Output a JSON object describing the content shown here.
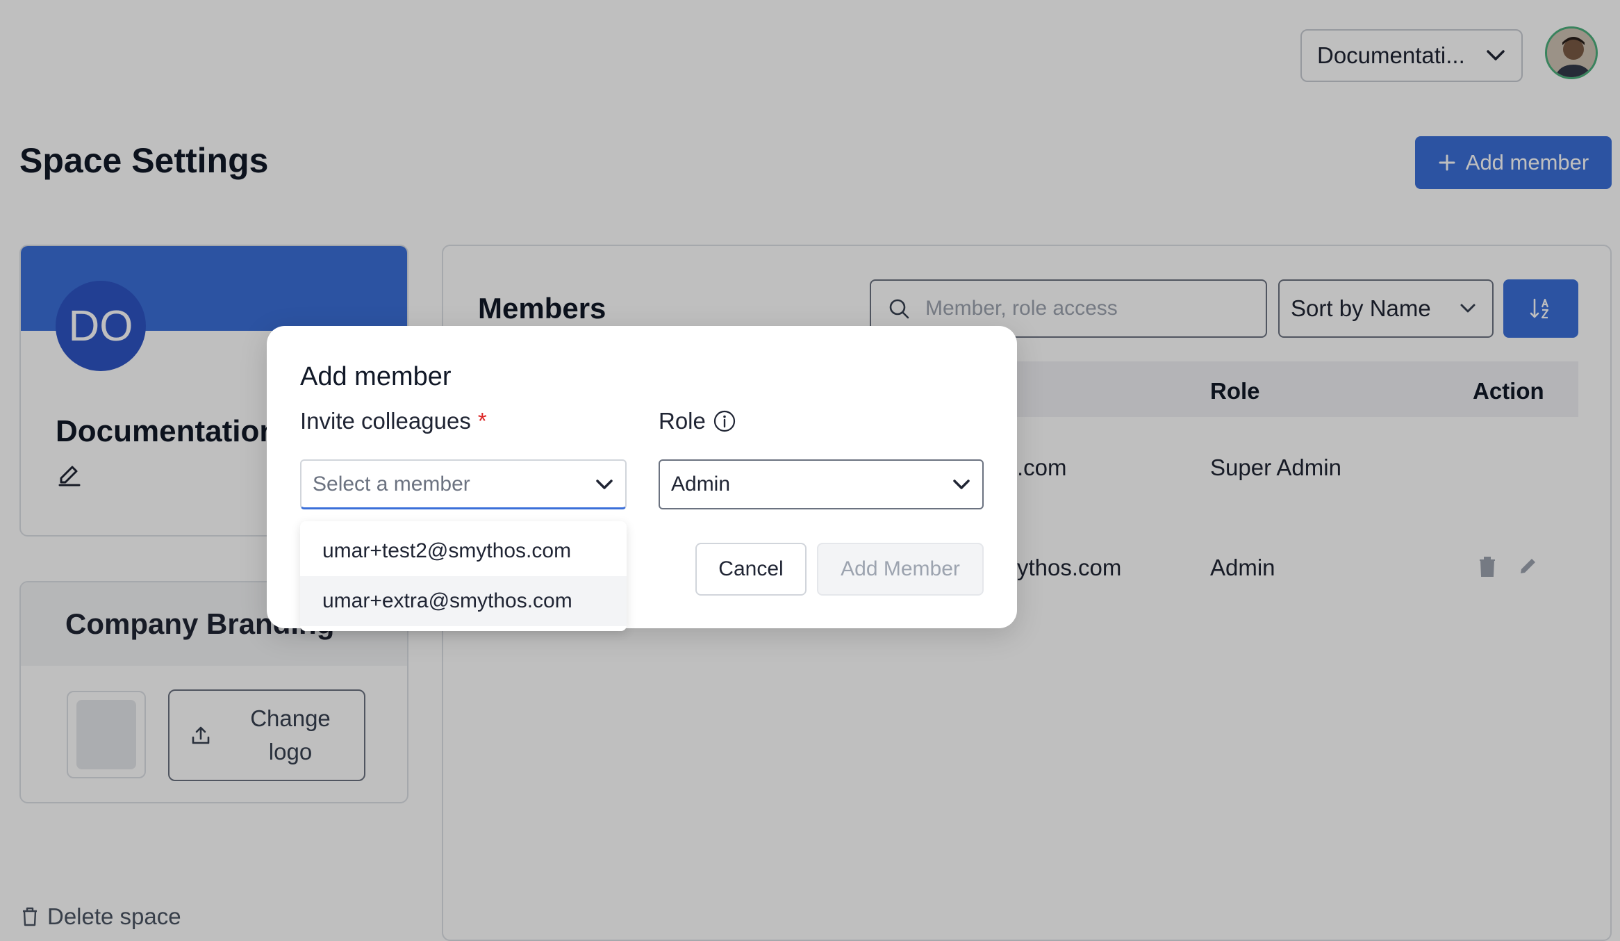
{
  "header": {
    "space_switcher_label": "Documentati...",
    "page_title": "Space Settings",
    "add_member_label": "Add member"
  },
  "space_card": {
    "initials": "DO",
    "name": "Documentation"
  },
  "branding": {
    "title": "Company Branding",
    "change_logo_label": "Change logo"
  },
  "delete_space_label": "Delete space",
  "members": {
    "title": "Members",
    "search_placeholder": "Member, role access",
    "sort_label": "Sort by Name",
    "columns": [
      "Role",
      "Action"
    ],
    "rows": [
      {
        "email_fragment": ".com",
        "role": "Super Admin"
      },
      {
        "email_fragment": "ythos.com",
        "role": "Admin"
      }
    ]
  },
  "modal": {
    "title": "Add member",
    "invite_label": "Invite colleagues",
    "required_mark": "*",
    "role_label": "Role",
    "member_placeholder": "Select a member",
    "role_value": "Admin",
    "cancel_label": "Cancel",
    "submit_label": "Add Member",
    "options": [
      "umar+test2@smythos.com",
      "umar+extra@smythos.com"
    ]
  },
  "colors": {
    "primary": "#3b6fd9",
    "required": "#dc2626"
  }
}
